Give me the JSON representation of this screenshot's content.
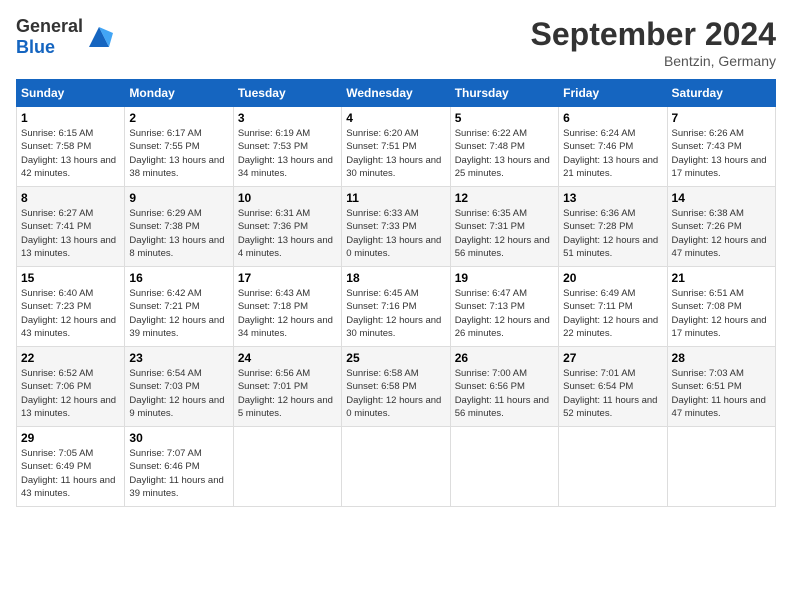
{
  "header": {
    "logo_general": "General",
    "logo_blue": "Blue",
    "month_title": "September 2024",
    "location": "Bentzin, Germany"
  },
  "weekdays": [
    "Sunday",
    "Monday",
    "Tuesday",
    "Wednesday",
    "Thursday",
    "Friday",
    "Saturday"
  ],
  "weeks": [
    [
      {
        "day": "1",
        "sunrise": "6:15 AM",
        "sunset": "7:58 PM",
        "daylight": "13 hours and 42 minutes."
      },
      {
        "day": "2",
        "sunrise": "6:17 AM",
        "sunset": "7:55 PM",
        "daylight": "13 hours and 38 minutes."
      },
      {
        "day": "3",
        "sunrise": "6:19 AM",
        "sunset": "7:53 PM",
        "daylight": "13 hours and 34 minutes."
      },
      {
        "day": "4",
        "sunrise": "6:20 AM",
        "sunset": "7:51 PM",
        "daylight": "13 hours and 30 minutes."
      },
      {
        "day": "5",
        "sunrise": "6:22 AM",
        "sunset": "7:48 PM",
        "daylight": "13 hours and 25 minutes."
      },
      {
        "day": "6",
        "sunrise": "6:24 AM",
        "sunset": "7:46 PM",
        "daylight": "13 hours and 21 minutes."
      },
      {
        "day": "7",
        "sunrise": "6:26 AM",
        "sunset": "7:43 PM",
        "daylight": "13 hours and 17 minutes."
      }
    ],
    [
      {
        "day": "8",
        "sunrise": "6:27 AM",
        "sunset": "7:41 PM",
        "daylight": "13 hours and 13 minutes."
      },
      {
        "day": "9",
        "sunrise": "6:29 AM",
        "sunset": "7:38 PM",
        "daylight": "13 hours and 8 minutes."
      },
      {
        "day": "10",
        "sunrise": "6:31 AM",
        "sunset": "7:36 PM",
        "daylight": "13 hours and 4 minutes."
      },
      {
        "day": "11",
        "sunrise": "6:33 AM",
        "sunset": "7:33 PM",
        "daylight": "13 hours and 0 minutes."
      },
      {
        "day": "12",
        "sunrise": "6:35 AM",
        "sunset": "7:31 PM",
        "daylight": "12 hours and 56 minutes."
      },
      {
        "day": "13",
        "sunrise": "6:36 AM",
        "sunset": "7:28 PM",
        "daylight": "12 hours and 51 minutes."
      },
      {
        "day": "14",
        "sunrise": "6:38 AM",
        "sunset": "7:26 PM",
        "daylight": "12 hours and 47 minutes."
      }
    ],
    [
      {
        "day": "15",
        "sunrise": "6:40 AM",
        "sunset": "7:23 PM",
        "daylight": "12 hours and 43 minutes."
      },
      {
        "day": "16",
        "sunrise": "6:42 AM",
        "sunset": "7:21 PM",
        "daylight": "12 hours and 39 minutes."
      },
      {
        "day": "17",
        "sunrise": "6:43 AM",
        "sunset": "7:18 PM",
        "daylight": "12 hours and 34 minutes."
      },
      {
        "day": "18",
        "sunrise": "6:45 AM",
        "sunset": "7:16 PM",
        "daylight": "12 hours and 30 minutes."
      },
      {
        "day": "19",
        "sunrise": "6:47 AM",
        "sunset": "7:13 PM",
        "daylight": "12 hours and 26 minutes."
      },
      {
        "day": "20",
        "sunrise": "6:49 AM",
        "sunset": "7:11 PM",
        "daylight": "12 hours and 22 minutes."
      },
      {
        "day": "21",
        "sunrise": "6:51 AM",
        "sunset": "7:08 PM",
        "daylight": "12 hours and 17 minutes."
      }
    ],
    [
      {
        "day": "22",
        "sunrise": "6:52 AM",
        "sunset": "7:06 PM",
        "daylight": "12 hours and 13 minutes."
      },
      {
        "day": "23",
        "sunrise": "6:54 AM",
        "sunset": "7:03 PM",
        "daylight": "12 hours and 9 minutes."
      },
      {
        "day": "24",
        "sunrise": "6:56 AM",
        "sunset": "7:01 PM",
        "daylight": "12 hours and 5 minutes."
      },
      {
        "day": "25",
        "sunrise": "6:58 AM",
        "sunset": "6:58 PM",
        "daylight": "12 hours and 0 minutes."
      },
      {
        "day": "26",
        "sunrise": "7:00 AM",
        "sunset": "6:56 PM",
        "daylight": "11 hours and 56 minutes."
      },
      {
        "day": "27",
        "sunrise": "7:01 AM",
        "sunset": "6:54 PM",
        "daylight": "11 hours and 52 minutes."
      },
      {
        "day": "28",
        "sunrise": "7:03 AM",
        "sunset": "6:51 PM",
        "daylight": "11 hours and 47 minutes."
      }
    ],
    [
      {
        "day": "29",
        "sunrise": "7:05 AM",
        "sunset": "6:49 PM",
        "daylight": "11 hours and 43 minutes."
      },
      {
        "day": "30",
        "sunrise": "7:07 AM",
        "sunset": "6:46 PM",
        "daylight": "11 hours and 39 minutes."
      },
      null,
      null,
      null,
      null,
      null
    ]
  ]
}
